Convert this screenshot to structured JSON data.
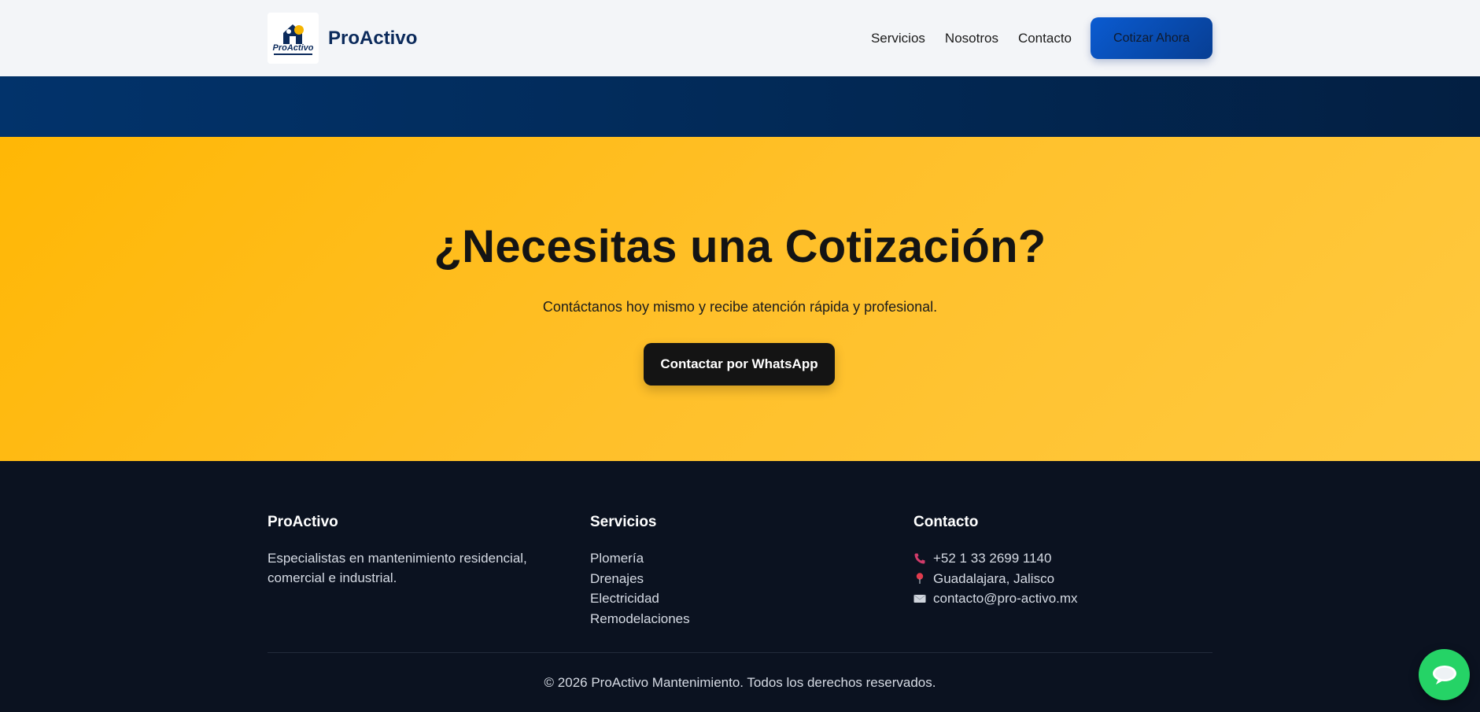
{
  "header": {
    "brand_name": "ProActivo",
    "logo_text": "ProActivo",
    "nav": [
      {
        "label": "Servicios"
      },
      {
        "label": "Nosotros"
      },
      {
        "label": "Contacto"
      }
    ],
    "cta_label": "Cotizar Ahora"
  },
  "cta_section": {
    "title": "¿Necesitas una Cotización?",
    "subtitle": "Contáctanos hoy mismo y recibe atención rápida y profesional.",
    "button_label": "Contactar por WhatsApp"
  },
  "footer": {
    "about": {
      "title": "ProActivo",
      "text_line1": "Especialistas en mantenimiento residencial,",
      "text_line2": "comercial e industrial."
    },
    "services": {
      "title": "Servicios",
      "items": [
        "Plomería",
        "Drenajes",
        "Electricidad",
        "Remodelaciones"
      ]
    },
    "contact": {
      "title": "Contacto",
      "phone": "+52 1 33 2699 1140",
      "location": "Guadalajara, Jalisco",
      "email": "contacto@pro-activo.mx"
    },
    "copyright": "© 2026 ProActivo Mantenimiento. Todos los derechos reservados."
  },
  "colors": {
    "header_bg": "#f3f5f8",
    "brand_navy": "#0b2a5b",
    "cta_blue": "#0a5bd1",
    "band_blue": "#02336b",
    "yellow": "#ffb705",
    "footer_bg": "#0b1220",
    "whatsapp_green": "#25d366"
  },
  "icons": {
    "phone": "phone-icon",
    "location": "map-pin-icon",
    "email": "envelope-icon",
    "whatsapp": "chat-bubble-icon"
  }
}
